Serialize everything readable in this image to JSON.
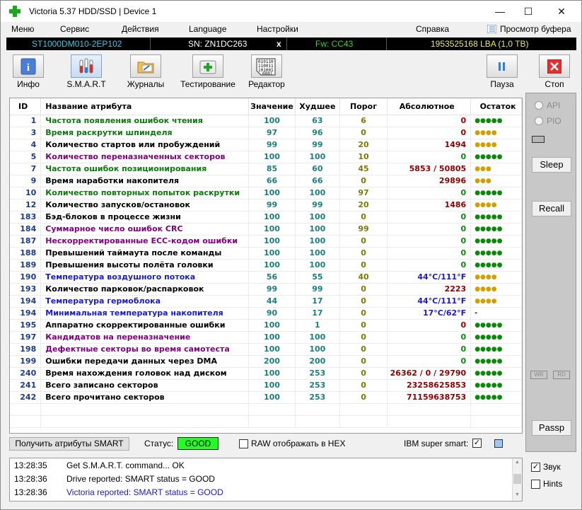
{
  "window": {
    "title": "Victoria 5.37 HDD/SSD | Device 1",
    "minimize": "—",
    "maximize": "☐",
    "close": "✕"
  },
  "menu": {
    "items": [
      "Меню",
      "Сервис",
      "Действия",
      "Language",
      "Настройки",
      "Справка"
    ],
    "buffer_view": "Просмотр буфера"
  },
  "drive": {
    "model": "ST1000DM010-2EP102",
    "serial": "SN: ZN1DC263",
    "x": "x",
    "firmware": "Fw: CC43",
    "lba": "1953525168 LBA (1,0 TB)"
  },
  "toolbar": {
    "info": "Инфо",
    "smart": "S.M.A.R.T",
    "journals": "Журналы",
    "testing": "Тестирование",
    "editor": "Редактор",
    "pause": "Пауза",
    "stop": "Стоп"
  },
  "table": {
    "headers": [
      "ID",
      "Название атрибута",
      "Значение",
      "Худшее",
      "Порог",
      "Абсолютное",
      "Остаток"
    ],
    "rows": [
      {
        "id": "1",
        "name": "Частота появления ошибок чтения",
        "value": "100",
        "worst": "63",
        "threshold": "6",
        "raw": "0",
        "remain": "●●●●●",
        "nameColor": "#0a7a0a",
        "rawColor": "#a00000",
        "remColor": "#0a8a0a"
      },
      {
        "id": "3",
        "name": "Время раскрутки шпинделя",
        "value": "97",
        "worst": "96",
        "threshold": "0",
        "raw": "0",
        "remain": "●●●●",
        "nameColor": "#0a7a0a",
        "rawColor": "#a00000",
        "remColor": "#d0a000"
      },
      {
        "id": "4",
        "name": "Количество стартов или пробуждений",
        "value": "99",
        "worst": "99",
        "threshold": "20",
        "raw": "1494",
        "remain": "●●●●",
        "nameColor": "#000000",
        "rawColor": "#8b0000",
        "remColor": "#d0a000"
      },
      {
        "id": "5",
        "name": "Количество переназначенных секторов",
        "value": "100",
        "worst": "100",
        "threshold": "10",
        "raw": "0",
        "remain": "●●●●●",
        "nameColor": "#800080",
        "rawColor": "#0a8a0a",
        "remColor": "#0a8a0a"
      },
      {
        "id": "7",
        "name": "Частота ошибок позиционирования",
        "value": "85",
        "worst": "60",
        "threshold": "45",
        "raw": "5853 / 50805",
        "remain": "●●●",
        "nameColor": "#0a7a0a",
        "rawColor": "#8b0000",
        "remColor": "#d0a000"
      },
      {
        "id": "9",
        "name": "Время наработки накопителя",
        "value": "66",
        "worst": "66",
        "threshold": "0",
        "raw": "29896",
        "remain": "●●●",
        "nameColor": "#000000",
        "rawColor": "#8b0000",
        "remColor": "#d0a000"
      },
      {
        "id": "10",
        "name": "Количество повторных попыток раскрутки",
        "value": "100",
        "worst": "100",
        "threshold": "97",
        "raw": "0",
        "remain": "●●●●●",
        "nameColor": "#0a7a0a",
        "rawColor": "#0a8a0a",
        "remColor": "#0a8a0a"
      },
      {
        "id": "12",
        "name": "Количество запусков/остановок",
        "value": "99",
        "worst": "99",
        "threshold": "20",
        "raw": "1486",
        "remain": "●●●●",
        "nameColor": "#000000",
        "rawColor": "#8b0000",
        "remColor": "#d0a000"
      },
      {
        "id": "183",
        "name": "Бэд-блоков в процессе жизни",
        "value": "100",
        "worst": "100",
        "threshold": "0",
        "raw": "0",
        "remain": "●●●●●",
        "nameColor": "#000000",
        "rawColor": "#0a8a0a",
        "remColor": "#0a8a0a"
      },
      {
        "id": "184",
        "name": "Суммарное число ошибок CRC",
        "value": "100",
        "worst": "100",
        "threshold": "99",
        "raw": "0",
        "remain": "●●●●●",
        "nameColor": "#800080",
        "rawColor": "#0a8a0a",
        "remColor": "#0a8a0a"
      },
      {
        "id": "187",
        "name": "Нескорректированные ECC-кодом ошибки",
        "value": "100",
        "worst": "100",
        "threshold": "0",
        "raw": "0",
        "remain": "●●●●●",
        "nameColor": "#800080",
        "rawColor": "#0a8a0a",
        "remColor": "#0a8a0a"
      },
      {
        "id": "188",
        "name": "Превышений таймаута после команды",
        "value": "100",
        "worst": "100",
        "threshold": "0",
        "raw": "0",
        "remain": "●●●●●",
        "nameColor": "#000000",
        "rawColor": "#0a8a0a",
        "remColor": "#0a8a0a"
      },
      {
        "id": "189",
        "name": "Превышения высоты полёта головки",
        "value": "100",
        "worst": "100",
        "threshold": "0",
        "raw": "0",
        "remain": "●●●●●",
        "nameColor": "#000000",
        "rawColor": "#0a8a0a",
        "remColor": "#0a8a0a"
      },
      {
        "id": "190",
        "name": "Температура воздушного потока",
        "value": "56",
        "worst": "55",
        "threshold": "40",
        "raw": "44°C/111°F",
        "remain": "●●●●",
        "nameColor": "#1a1acc",
        "rawColor": "#1a1acc",
        "remColor": "#d0a000"
      },
      {
        "id": "193",
        "name": "Количество парковок/распарковок",
        "value": "99",
        "worst": "99",
        "threshold": "0",
        "raw": "2223",
        "remain": "●●●●",
        "nameColor": "#000000",
        "rawColor": "#8b0000",
        "remColor": "#d0a000"
      },
      {
        "id": "194",
        "name": "Температура гермоблока",
        "value": "44",
        "worst": "17",
        "threshold": "0",
        "raw": "44°C/111°F",
        "remain": "●●●●",
        "nameColor": "#1a1acc",
        "rawColor": "#1a1acc",
        "remColor": "#d0a000"
      },
      {
        "id": "194",
        "name": "Минимальная температура накопителя",
        "value": "90",
        "worst": "17",
        "threshold": "0",
        "raw": "17°C/62°F",
        "remain": "-",
        "nameColor": "#1a1acc",
        "rawColor": "#1a1acc",
        "remColor": "#000000"
      },
      {
        "id": "195",
        "name": "Аппаратно скорректированные ошибки",
        "value": "100",
        "worst": "1",
        "threshold": "0",
        "raw": "0",
        "remain": "●●●●●",
        "nameColor": "#000000",
        "rawColor": "#a00000",
        "remColor": "#0a8a0a"
      },
      {
        "id": "197",
        "name": "Кандидатов на переназначение",
        "value": "100",
        "worst": "100",
        "threshold": "0",
        "raw": "0",
        "remain": "●●●●●",
        "nameColor": "#800080",
        "rawColor": "#0a8a0a",
        "remColor": "#0a8a0a"
      },
      {
        "id": "198",
        "name": "Дефектные секторы во время самотеста",
        "value": "100",
        "worst": "100",
        "threshold": "0",
        "raw": "0",
        "remain": "●●●●●",
        "nameColor": "#800080",
        "rawColor": "#0a8a0a",
        "remColor": "#0a8a0a"
      },
      {
        "id": "199",
        "name": "Ошибки передачи данных через DMA",
        "value": "200",
        "worst": "200",
        "threshold": "0",
        "raw": "0",
        "remain": "●●●●●",
        "nameColor": "#000000",
        "rawColor": "#0a8a0a",
        "remColor": "#0a8a0a"
      },
      {
        "id": "240",
        "name": "Время нахождения головок над диском",
        "value": "100",
        "worst": "253",
        "threshold": "0",
        "raw": "26362 / 0 / 29790",
        "remain": "●●●●●",
        "nameColor": "#000000",
        "rawColor": "#8b0000",
        "remColor": "#0a8a0a"
      },
      {
        "id": "241",
        "name": "Всего записано секторов",
        "value": "100",
        "worst": "253",
        "threshold": "0",
        "raw": "23258625853",
        "remain": "●●●●●",
        "nameColor": "#000000",
        "rawColor": "#8b0000",
        "remColor": "#0a8a0a"
      },
      {
        "id": "242",
        "name": "Всего прочитано секторов",
        "value": "100",
        "worst": "253",
        "threshold": "0",
        "raw": "71159638753",
        "remain": "●●●●●",
        "nameColor": "#000000",
        "rawColor": "#8b0000",
        "remColor": "#0a8a0a"
      }
    ]
  },
  "bottom": {
    "get_smart": "Получить атрибуты SMART",
    "status_label": "Статус:",
    "status_value": "GOOD",
    "raw_hex": "RAW отображать в HEX",
    "ibm": "IBM super smart:",
    "ibm_check": "✓"
  },
  "right": {
    "api": "API",
    "pio": "PIO",
    "sleep": "Sleep",
    "recall": "Recall",
    "wr": "WR",
    "rd": "RD",
    "passp": "Passp"
  },
  "log": [
    {
      "time": "13:28:35",
      "text": "Get S.M.A.R.T. command... OK",
      "color": "#000000"
    },
    {
      "time": "13:28:36",
      "text": "Drive reported: SMART status = GOOD",
      "color": "#000000"
    },
    {
      "time": "13:28:36",
      "text": "Victoria reported: SMART status = GOOD",
      "color": "#1a1acc"
    }
  ],
  "checks": {
    "sound": "Звук",
    "sound_mark": "✓",
    "hints": "Hints"
  }
}
